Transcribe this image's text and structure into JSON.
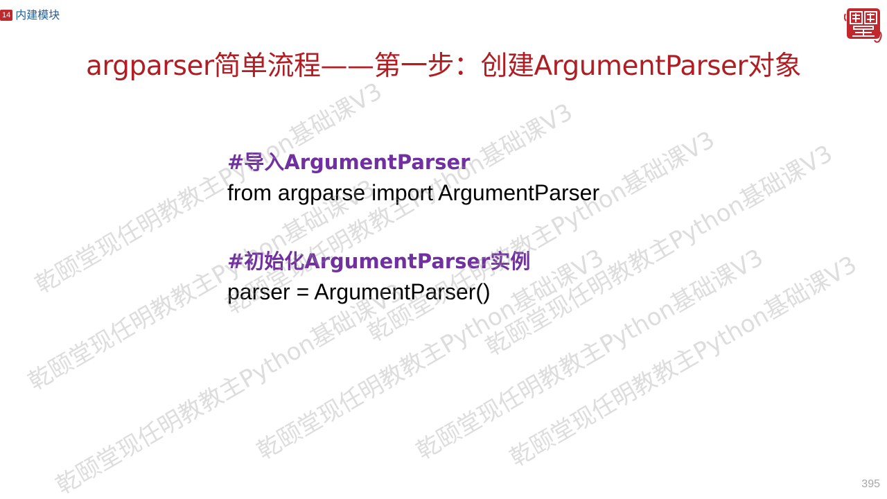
{
  "section": {
    "number": "14",
    "title": "内建模块"
  },
  "logo": {
    "text": "颐乾堂",
    "color": "#c0282d"
  },
  "title": "argparser简单流程——第一步：创建ArgumentParser对象",
  "blocks": [
    {
      "comment": "#导入ArgumentParser",
      "code": "from argparse import ArgumentParser"
    },
    {
      "comment": "#初始化ArgumentParser实例",
      "code": "parser = ArgumentParser()"
    }
  ],
  "watermark": "乾颐堂现任明教教主Python基础课V3",
  "page_number": "395",
  "colors": {
    "title": "#b01e24",
    "comment": "#7030a0",
    "section_badge": "#c0282d",
    "section_title": "#1f5fa3"
  }
}
